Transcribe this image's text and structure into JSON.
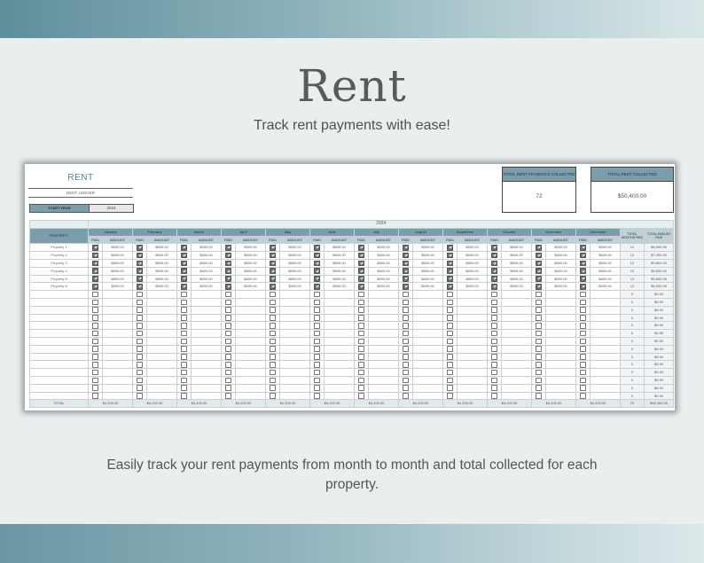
{
  "hero": {
    "title": "Rent",
    "subtitle": "Track rent payments with ease!",
    "footer": "Easily track your rent payments from month to month and total collected for each property."
  },
  "sheet": {
    "title": "RENT",
    "subtitle": "RENT LEDGER",
    "start_year_label": "START YEAR",
    "start_year_value": "2024",
    "kpi_payments_label": "TOTAL RENT PAYMENTS COLLECTED",
    "kpi_payments_value": "72",
    "kpi_total_label": "TOTAL RENT COLLECTED",
    "kpi_total_value": "$50,400.00",
    "year_header": "2024",
    "property_header": "PROPERTY",
    "paid_header": "PAID",
    "amount_header": "AMOUNT",
    "total_months_header": "TOTAL MONTHS PAID",
    "total_amount_header": "TOTAL AMOUNT PAID",
    "months": [
      "January",
      "February",
      "March",
      "April",
      "May",
      "June",
      "July",
      "August",
      "September",
      "October",
      "November",
      "December"
    ],
    "properties": [
      {
        "name": "Property 1",
        "amount": "$500.00",
        "months_paid": "12",
        "total": "$6,000.00"
      },
      {
        "name": "Property 2",
        "amount": "$600.00",
        "months_paid": "12",
        "total": "$7,200.00"
      },
      {
        "name": "Property 3",
        "amount": "$800.00",
        "months_paid": "12",
        "total": "$9,600.00"
      },
      {
        "name": "Property 4",
        "amount": "$800.00",
        "months_paid": "12",
        "total": "$9,600.00"
      },
      {
        "name": "Property 5",
        "amount": "$800.00",
        "months_paid": "12",
        "total": "$9,600.00"
      },
      {
        "name": "Property 6",
        "amount": "$500.00",
        "months_paid": "12",
        "total": "$6,000.00"
      }
    ],
    "empty_rows": 14,
    "empty_months_paid": "0",
    "empty_total": "$0.00",
    "total_label": "TOTAL",
    "month_total": "$4,200.00",
    "grand_months": "72",
    "grand_total": "$50,400.00"
  }
}
